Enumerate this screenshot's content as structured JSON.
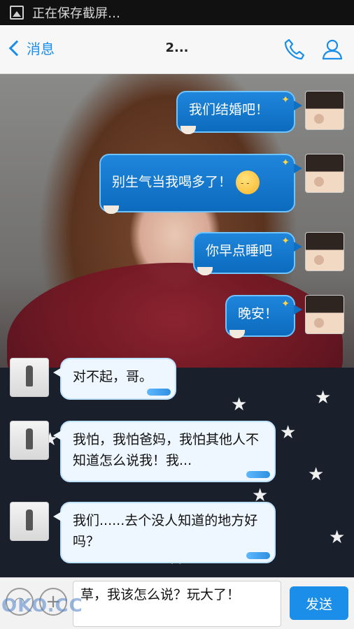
{
  "status_bar": {
    "notification_text": "正在保存截屏…",
    "icon": "image-icon"
  },
  "nav": {
    "back_label": "消息",
    "title": "2...",
    "icons": [
      "phone-icon",
      "user-icon"
    ]
  },
  "messages": [
    {
      "from": "me",
      "text": "我们结婚吧！"
    },
    {
      "from": "me",
      "text": "别生气当我喝多了！",
      "emoji": "sleepy-face"
    },
    {
      "from": "me",
      "text": "你早点睡吧"
    },
    {
      "from": "me",
      "text": "晚安！"
    },
    {
      "from": "other",
      "text": "对不起，哥。"
    },
    {
      "from": "other",
      "text": "我怕，我怕爸妈，我怕其他人不知道怎么说我！我..."
    },
    {
      "from": "other",
      "text": "我们......去个没人知道的地方好吗？"
    }
  ],
  "input": {
    "value": "草，我该怎么说？玩大了！"
  },
  "send_label": "发送",
  "watermark": "OKO.CC",
  "colors": {
    "accent": "#1a8ee8",
    "bubble_me": "#0c6bbd",
    "bubble_other": "#eef7ff"
  }
}
